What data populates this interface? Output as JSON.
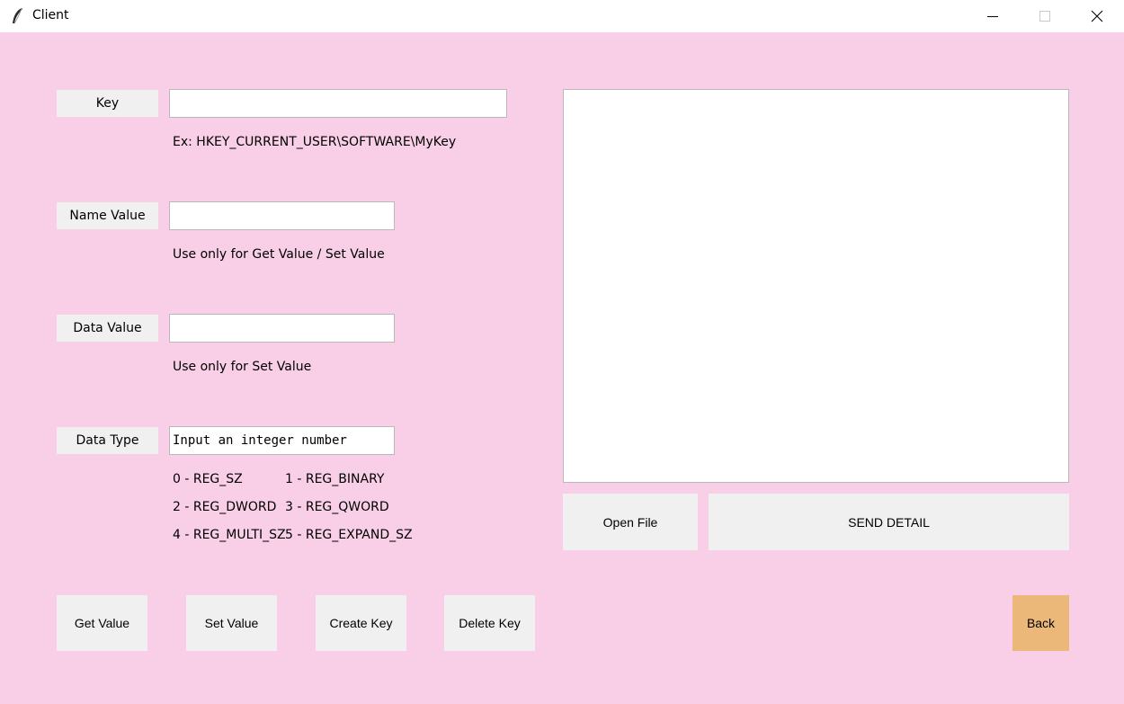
{
  "window": {
    "title": "Client",
    "app_icon": "feather-icon"
  },
  "form": {
    "key": {
      "label": "Key",
      "value": "",
      "hint": "Ex: HKEY_CURRENT_USER\\SOFTWARE\\MyKey"
    },
    "name_value": {
      "label": "Name Value",
      "value": "",
      "hint": "Use only for Get Value / Set Value"
    },
    "data_value": {
      "label": "Data Value",
      "value": "",
      "hint": "Use only for Set Value"
    },
    "data_type": {
      "label": "Data Type",
      "value": "Input an integer number",
      "types": [
        "0 - REG_SZ",
        "1 - REG_BINARY",
        "2 - REG_DWORD",
        "3 - REG_QWORD",
        "4 - REG_MULTI_SZ",
        "5 - REG_EXPAND_SZ"
      ]
    }
  },
  "actions": {
    "get_value": "Get Value",
    "set_value": "Set Value",
    "create_key": "Create Key",
    "delete_key": "Delete Key",
    "back": "Back"
  },
  "panel": {
    "output_text": "",
    "open_file": "Open File",
    "send_detail": "SEND DETAIL"
  },
  "colors": {
    "background": "#f9cfe8",
    "button": "#f0f0f0",
    "back_button": "#ebb87a"
  }
}
